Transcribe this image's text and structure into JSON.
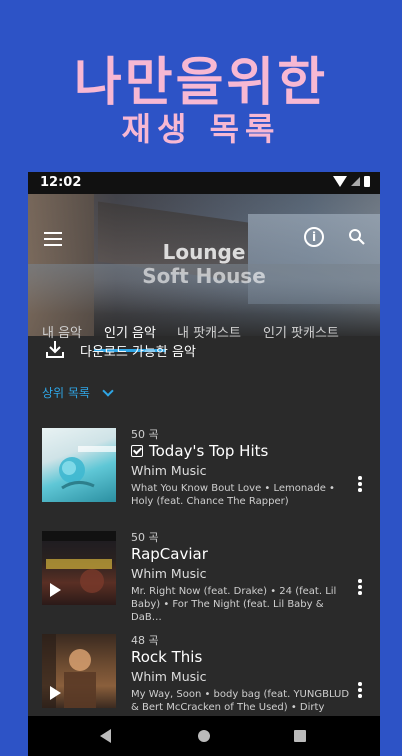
{
  "promo": {
    "title": "나만을위한",
    "subtitle": "재생 목록"
  },
  "statusbar": {
    "time": "12:02"
  },
  "hero": {
    "line1": "Lounge",
    "line2": "Soft House"
  },
  "tabs": [
    {
      "label": "내 음악"
    },
    {
      "label": "인기 음악"
    },
    {
      "label": "내 팟캐스트"
    },
    {
      "label": "인기 팟캐스트"
    }
  ],
  "download": {
    "label": "다운로드 가능한 음악"
  },
  "filter": {
    "label": "상위 목록"
  },
  "playlists": [
    {
      "count": "50 곡",
      "title": "Today's Top Hits",
      "owner": "Whim Music",
      "desc": "What You Know Bout Love • Lemonade • Holy (feat. Chance The Rapper)"
    },
    {
      "count": "50 곡",
      "title": "RapCaviar",
      "owner": "Whim Music",
      "desc": "Mr. Right Now (feat. Drake) • 24 (feat. Lil Baby) • For The Night (feat. Lil Baby & DaB…"
    },
    {
      "count": "48 곡",
      "title": "Rock This",
      "owner": "Whim Music",
      "desc": "My Way, Soon • body bag (feat. YUNGBLUD & Bert McCracken of The Used) • Dirty"
    }
  ],
  "colors": {
    "accent": "#2fa6e6",
    "promo_bg": "#2d53c6",
    "promo_text": "#f7b8d3"
  }
}
